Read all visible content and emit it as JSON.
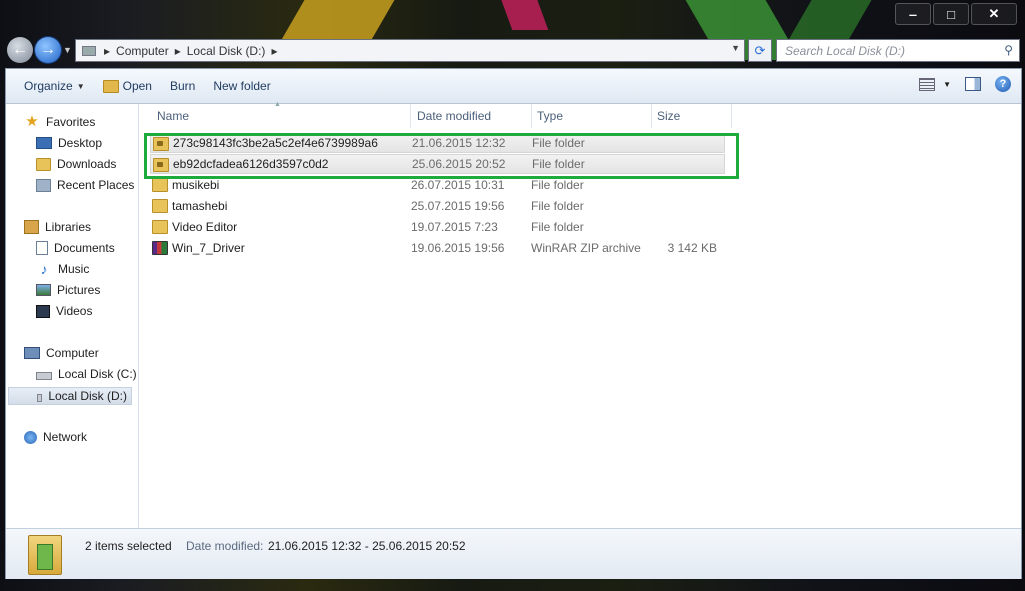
{
  "window": {
    "minimize_label": "‒",
    "maximize_label": "□",
    "close_label": "✕"
  },
  "address_bar": {
    "crumbs": [
      "Computer",
      "Local Disk (D:)"
    ]
  },
  "search": {
    "placeholder": "Search Local Disk (D:)"
  },
  "toolbar": {
    "organize": "Organize",
    "open": "Open",
    "burn": "Burn",
    "new_folder": "New folder"
  },
  "navpane": {
    "favorites": "Favorites",
    "desktop": "Desktop",
    "downloads": "Downloads",
    "recent_places": "Recent Places",
    "libraries": "Libraries",
    "documents": "Documents",
    "music": "Music",
    "pictures": "Pictures",
    "videos": "Videos",
    "computer": "Computer",
    "local_c": "Local Disk (C:)",
    "local_d": "Local Disk (D:)",
    "network": "Network"
  },
  "columns": {
    "name": "Name",
    "date": "Date modified",
    "type": "Type",
    "size": "Size"
  },
  "files": [
    {
      "name": "273c98143fc3be2a5c2ef4e6739989a6",
      "date": "21.06.2015 12:32",
      "type": "File folder",
      "size": ""
    },
    {
      "name": "eb92dcfadea6126d3597c0d2",
      "date": "25.06.2015 20:52",
      "type": "File folder",
      "size": ""
    },
    {
      "name": "musikebi",
      "date": "26.07.2015 10:31",
      "type": "File folder",
      "size": ""
    },
    {
      "name": "tamashebi",
      "date": "25.07.2015 19:56",
      "type": "File folder",
      "size": ""
    },
    {
      "name": "Video Editor",
      "date": "19.07.2015 7:23",
      "type": "File folder",
      "size": ""
    },
    {
      "name": "Win_7_Driver",
      "date": "19.06.2015 19:56",
      "type": "WinRAR ZIP archive",
      "size": "3 142 KB"
    }
  ],
  "details": {
    "count": "2 items selected",
    "date_label": "Date modified:",
    "date_value": "21.06.2015 12:32 - 25.06.2015 20:52"
  },
  "colors": {
    "highlight": "#1eaa3c",
    "accent": "#2a6fd4"
  }
}
